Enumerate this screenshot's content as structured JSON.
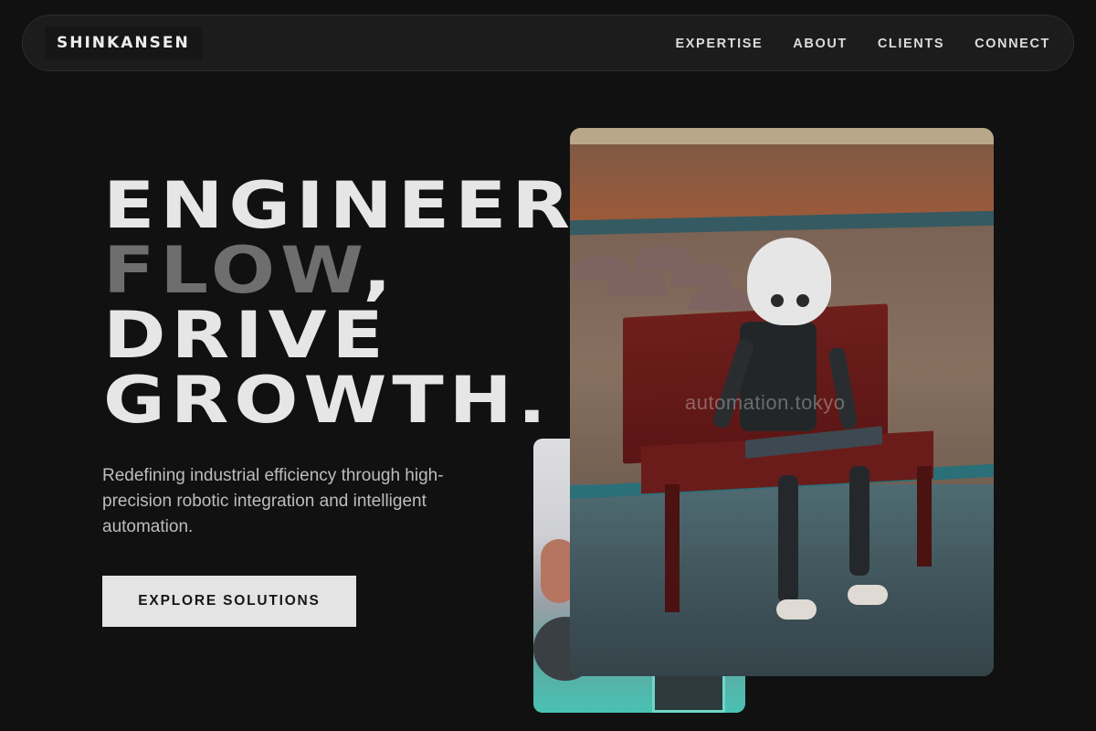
{
  "brand": "SHINKANSEN",
  "nav": {
    "items": [
      "EXPERTISE",
      "ABOUT",
      "CLIENTS",
      "CONNECT"
    ]
  },
  "hero": {
    "line1": "ENGINEER",
    "line2_muted": "FLOW",
    "line2_punct": ",",
    "line3": "DRIVE",
    "line4": "GROWTH.",
    "subtitle": "Redefining industrial efficiency through high-precision robotic integration and intelligent automation.",
    "cta_label": "EXPLORE SOLUTIONS"
  },
  "images": {
    "main_watermark": "automation.tokyo"
  },
  "colors": {
    "background": "#111111",
    "nav_bg": "#1c1c1c",
    "heading": "#e6e6e6",
    "heading_muted": "#6e6e6e",
    "cta_bg": "#e4e4e4"
  }
}
